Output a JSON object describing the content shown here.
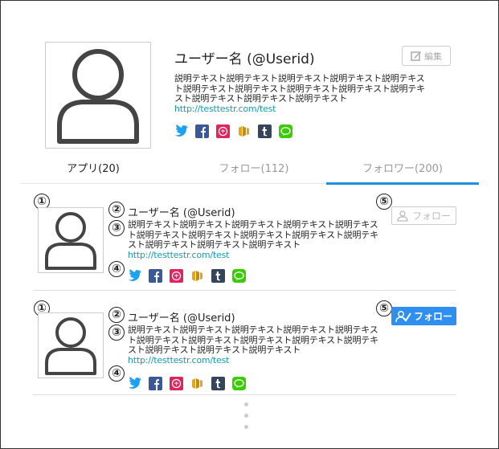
{
  "profile": {
    "name": "ユーザー名 (@Userid)",
    "description": "説明テキスト説明テキスト説明テキスト説明テキスト説明テキスト説明テキスト説明テキスト説明テキスト説明テキスト説明テキスト説明テキスト説明テキスト説明テキスト",
    "link": "http://testtestr.com/test",
    "edit_label": "編集"
  },
  "tabs": [
    {
      "label": "アプリ(20)"
    },
    {
      "label": "フォロー(112)"
    },
    {
      "label": "フォロワー(200)"
    }
  ],
  "list": [
    {
      "marker_avatar": "①",
      "marker_name": "②",
      "marker_desc": "③",
      "marker_social": "④",
      "marker_button": "⑤",
      "name": "ユーザー名 (@Userid)",
      "description": "説明テキスト説明テキスト説明テキスト説明テキスト説明テキスト説明テキスト説明テキスト説明テキスト説明テキスト説明テキスト説明テキスト説明テキスト説明テキスト",
      "link": "http://testtestr.com/test",
      "follow_label": "フォロー",
      "followed": false
    },
    {
      "marker_avatar": "①",
      "marker_name": "②",
      "marker_desc": "③",
      "marker_social": "④",
      "marker_button": "⑤",
      "name": "ユーザー名 (@Userid)",
      "description": "説明テキスト説明テキスト説明テキスト説明テキスト説明テキスト説明テキスト説明テキスト説明テキスト説明テキスト説明テキスト説明テキスト説明テキスト説明テキスト",
      "link": "http://testtestr.com/test",
      "follow_label": "フォロー",
      "followed": true
    }
  ],
  "social_icons": [
    "twitter-icon",
    "facebook-icon",
    "sns-red-icon",
    "sns-orange-icon",
    "tumblr-icon",
    "line-icon"
  ],
  "colors": {
    "accent": "#1e90e0",
    "follow_active": "#2e8ff0",
    "link": "#1a9ab0",
    "twitter": "#1da1f2",
    "facebook": "#3b5998",
    "red": "#e0245e",
    "orange": "#e8a317",
    "tumblr": "#35465c",
    "line": "#39cd00"
  }
}
